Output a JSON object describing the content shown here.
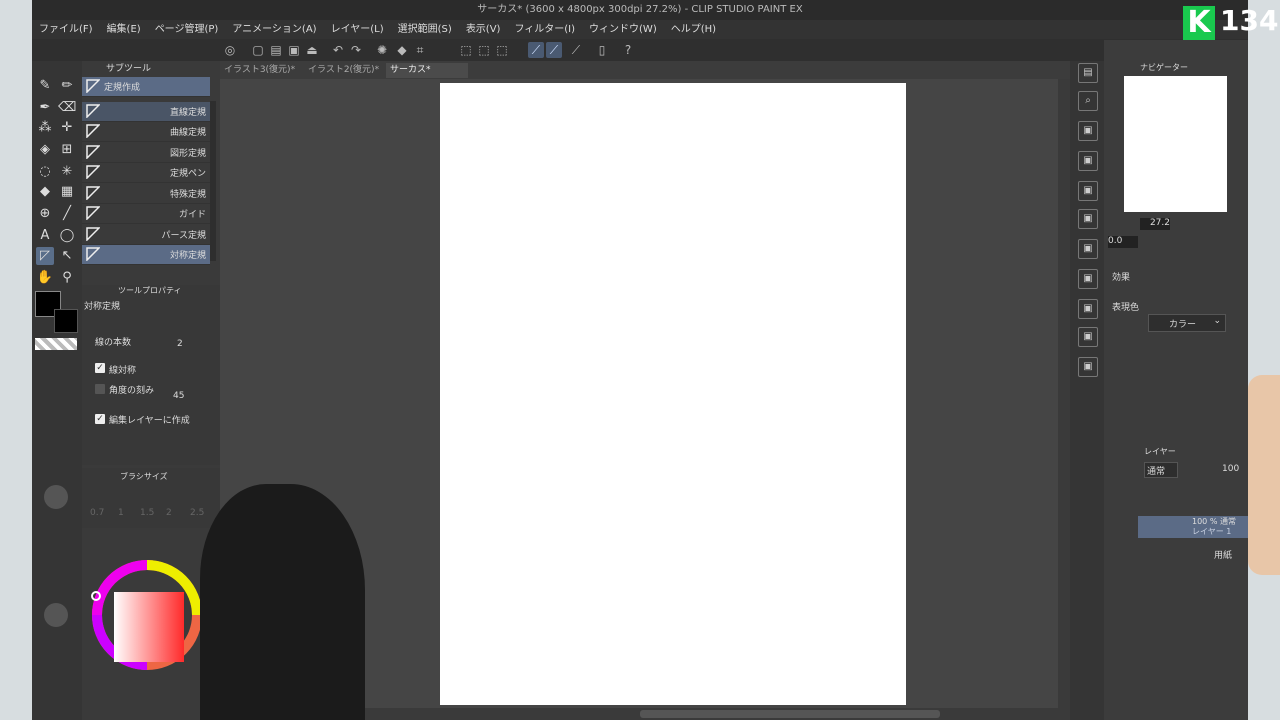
{
  "title": "サーカス* (3600 x 4800px 300dpi 27.2%) - CLIP STUDIO PAINT EX",
  "menu": [
    "ファイル(F)",
    "編集(E)",
    "ページ管理(P)",
    "アニメーション(A)",
    "レイヤー(L)",
    "選択範囲(S)",
    "表示(V)",
    "フィルター(I)",
    "ウィンドウ(W)",
    "ヘルプ(H)"
  ],
  "subtool": {
    "header": "サブツール",
    "items": [
      "定規作成",
      "直線定規",
      "曲線定規",
      "図形定規",
      "定規ペン",
      "特殊定規",
      "ガイド",
      "パース定規",
      "対称定規"
    ]
  },
  "tool_property": {
    "header": "ツールプロパティ",
    "tool_name": "対称定規",
    "line_count_label": "線の本数",
    "line_count_value": "2",
    "line_symmetry_label": "線対称",
    "angle_step_label": "角度の刻み",
    "angle_step_value": "45",
    "create_on_edit_label": "編集レイヤーに作成"
  },
  "brush_size": {
    "header": "ブラシサイズ",
    "sizes": [
      "0.7",
      "1",
      "1.5",
      "2",
      "2.5"
    ]
  },
  "tabs": [
    "イラスト3(復元)*",
    "イラスト2(復元)*",
    "サーカス*"
  ],
  "navigator": {
    "header": "ナビゲーター",
    "zoom": "27.2",
    "rotation": "0.0"
  },
  "effects": {
    "header": "効果",
    "expression_label": "表現色",
    "expression_value": "カラー"
  },
  "layers": {
    "header": "レイヤー",
    "blend_mode": "通常",
    "opacity": "100",
    "items": [
      {
        "line1": "100 % 通常",
        "line2": "レイヤー 1"
      },
      {
        "line1": "用紙",
        "line2": ""
      }
    ]
  },
  "overlay": {
    "viewer_count": "134",
    "logo_letter": "K"
  }
}
